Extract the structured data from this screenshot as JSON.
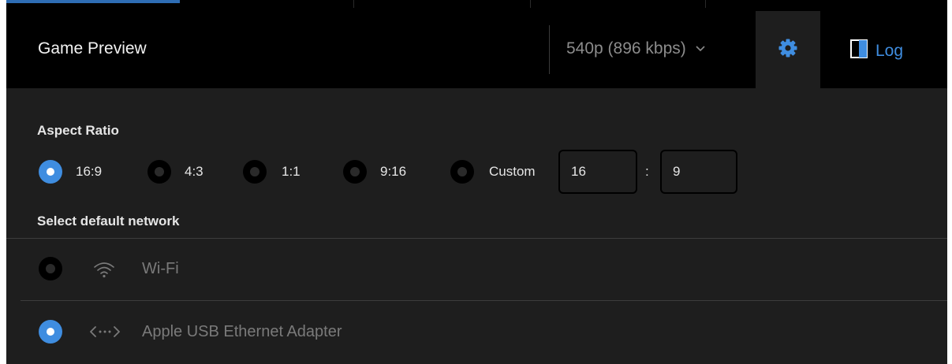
{
  "header": {
    "title": "Game Preview",
    "quality": "540p (896 kbps)",
    "log_label": "Log"
  },
  "icons": {
    "quality_dropdown": "chevron-down-icon",
    "settings": "gear-icon",
    "log": "panel-toggle-icon",
    "wifi": "wifi-icon",
    "ethernet": "ethernet-icon"
  },
  "colors": {
    "accent": "#3f8de0",
    "header_bg": "#000000",
    "panel_bg": "#1e1e1e"
  },
  "aspect_ratio": {
    "label": "Aspect Ratio",
    "options": [
      {
        "label": "16:9",
        "selected": true
      },
      {
        "label": "4:3",
        "selected": false
      },
      {
        "label": "1:1",
        "selected": false
      },
      {
        "label": "9:16",
        "selected": false
      },
      {
        "label": "Custom",
        "selected": false
      }
    ],
    "custom_width": "16",
    "separator": ":",
    "custom_height": "9"
  },
  "network": {
    "label": "Select default network",
    "options": [
      {
        "label": "Wi-Fi",
        "selected": false
      },
      {
        "label": "Apple USB Ethernet Adapter",
        "selected": true
      }
    ]
  }
}
